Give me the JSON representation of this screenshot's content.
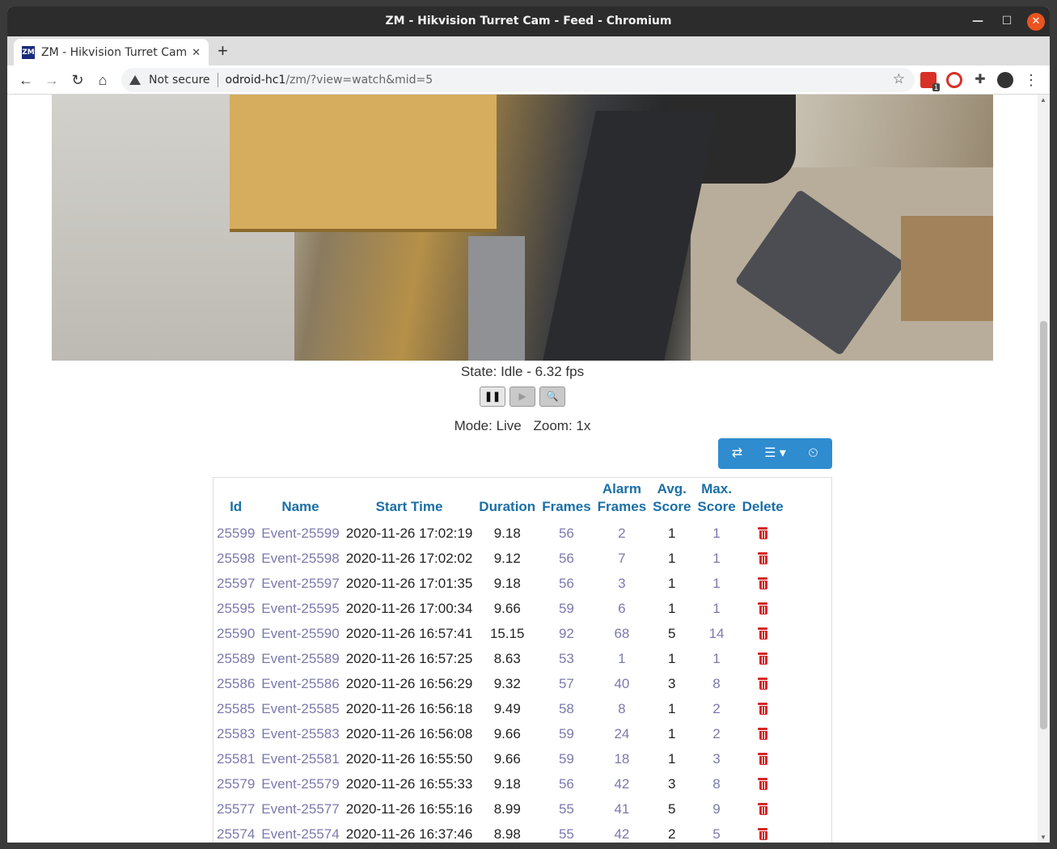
{
  "window": {
    "title": "ZM - Hikvision Turret Cam - Feed - Chromium"
  },
  "tab": {
    "title": "ZM - Hikvision Turret Cam - Feed",
    "favicon": "ZM"
  },
  "address": {
    "security": "Not secure",
    "host": "odroid-hc1",
    "path": "/zm/?view=watch&mid=5"
  },
  "extensions": {
    "badge": "1"
  },
  "monitor": {
    "state_label": "State: Idle - 6.32 fps",
    "mode_label": "Mode: Live",
    "zoom_label": "Zoom: 1x"
  },
  "controls": {
    "pause": "❚❚",
    "play": "▶",
    "zoom": "🔍"
  },
  "event_toolbar": {
    "refresh_icon": "⇄",
    "columns_icon": "☰ ▾",
    "history_icon": "⏲"
  },
  "table": {
    "headers": {
      "id": "Id",
      "name": "Name",
      "start_time": "Start Time",
      "duration": "Duration",
      "frames": "Frames",
      "alarm_frames_1": "Alarm",
      "alarm_frames_2": "Frames",
      "avg_score_1": "Avg.",
      "avg_score_2": "Score",
      "max_score_1": "Max.",
      "max_score_2": "Score",
      "delete": "Delete"
    },
    "rows": [
      {
        "id": "25599",
        "name": "Event-25599",
        "start": "2020-11-26 17:02:19",
        "duration": "9.18",
        "frames": "56",
        "alarm": "2",
        "avg": "1",
        "max": "1"
      },
      {
        "id": "25598",
        "name": "Event-25598",
        "start": "2020-11-26 17:02:02",
        "duration": "9.12",
        "frames": "56",
        "alarm": "7",
        "avg": "1",
        "max": "1"
      },
      {
        "id": "25597",
        "name": "Event-25597",
        "start": "2020-11-26 17:01:35",
        "duration": "9.18",
        "frames": "56",
        "alarm": "3",
        "avg": "1",
        "max": "1"
      },
      {
        "id": "25595",
        "name": "Event-25595",
        "start": "2020-11-26 17:00:34",
        "duration": "9.66",
        "frames": "59",
        "alarm": "6",
        "avg": "1",
        "max": "1"
      },
      {
        "id": "25590",
        "name": "Event-25590",
        "start": "2020-11-26 16:57:41",
        "duration": "15.15",
        "frames": "92",
        "alarm": "68",
        "avg": "5",
        "max": "14"
      },
      {
        "id": "25589",
        "name": "Event-25589",
        "start": "2020-11-26 16:57:25",
        "duration": "8.63",
        "frames": "53",
        "alarm": "1",
        "avg": "1",
        "max": "1"
      },
      {
        "id": "25586",
        "name": "Event-25586",
        "start": "2020-11-26 16:56:29",
        "duration": "9.32",
        "frames": "57",
        "alarm": "40",
        "avg": "3",
        "max": "8"
      },
      {
        "id": "25585",
        "name": "Event-25585",
        "start": "2020-11-26 16:56:18",
        "duration": "9.49",
        "frames": "58",
        "alarm": "8",
        "avg": "1",
        "max": "2"
      },
      {
        "id": "25583",
        "name": "Event-25583",
        "start": "2020-11-26 16:56:08",
        "duration": "9.66",
        "frames": "59",
        "alarm": "24",
        "avg": "1",
        "max": "2"
      },
      {
        "id": "25581",
        "name": "Event-25581",
        "start": "2020-11-26 16:55:50",
        "duration": "9.66",
        "frames": "59",
        "alarm": "18",
        "avg": "1",
        "max": "3"
      },
      {
        "id": "25579",
        "name": "Event-25579",
        "start": "2020-11-26 16:55:33",
        "duration": "9.18",
        "frames": "56",
        "alarm": "42",
        "avg": "3",
        "max": "8"
      },
      {
        "id": "25577",
        "name": "Event-25577",
        "start": "2020-11-26 16:55:16",
        "duration": "8.99",
        "frames": "55",
        "alarm": "41",
        "avg": "5",
        "max": "9"
      },
      {
        "id": "25574",
        "name": "Event-25574",
        "start": "2020-11-26 16:37:46",
        "duration": "8.98",
        "frames": "55",
        "alarm": "42",
        "avg": "2",
        "max": "5"
      }
    ]
  },
  "colors": {
    "accent": "#2e8ccf",
    "header_link": "#1b6fa6",
    "row_link": "#7a7aad",
    "delete": "#d52626",
    "ubuntu_close": "#e95420"
  }
}
